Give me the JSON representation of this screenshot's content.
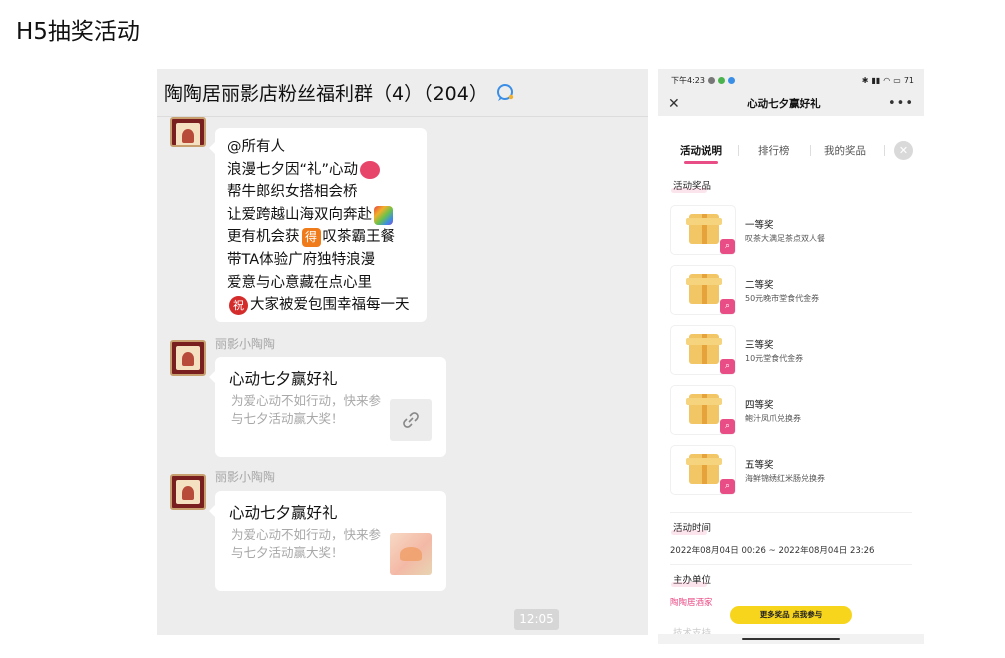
{
  "page_title": "H5抽奖活动",
  "chat": {
    "header": "陶陶居丽影店粉丝福利群（4）（204）",
    "announcement_lines": [
      "@所有人",
      "浪漫七夕因“礼”心动",
      "帮牛郎织女搭相会桥",
      "让爱跨越山海双向奔赴",
      "更有机会获",
      "叹茶霸王餐",
      "带TA体验广府独特浪漫",
      "爱意与心意藏在点心里",
      "大家被爱包围幸福每一天"
    ],
    "emoji_de": "得",
    "emoji_zhu": "祝",
    "messages": [
      {
        "sender": "丽影小陶陶",
        "card_title": "心动七夕赢好礼",
        "card_desc": "为爱心动不如行动，快来参与七夕活动赢大奖！"
      },
      {
        "sender": "丽影小陶陶",
        "card_title": "心动七夕赢好礼",
        "card_desc": "为爱心动不如行动，快来参与七夕活动赢大奖！"
      }
    ],
    "time": "12:05"
  },
  "phone": {
    "status_time": "下午4:23",
    "battery": "71",
    "nav_title": "心动七夕赢好礼",
    "tabs": [
      "活动说明",
      "排行榜",
      "我的奖品"
    ],
    "active_tab": "活动说明",
    "prizes_label": "活动奖品",
    "prizes": [
      {
        "name": "一等奖",
        "desc": "叹茶大满足茶点双人餐"
      },
      {
        "name": "二等奖",
        "desc": "50元晚市堂食代金券"
      },
      {
        "name": "三等奖",
        "desc": "10元堂食代金券"
      },
      {
        "name": "四等奖",
        "desc": "鲍汁凤爪兑换券"
      },
      {
        "name": "五等奖",
        "desc": "海鲜锦绣红米肠兑换券"
      }
    ],
    "time_label": "活动时间",
    "time_value": "2022年08月04日 00:26 ~ 2022年08月04日 23:26",
    "organizer_label": "主办单位",
    "organizer_value": "陶陶居酒家",
    "cta": "更多奖品  点我参与",
    "faded_label": "技术支持"
  },
  "colors": {
    "accent": "#e94d86",
    "cta": "#f7d51d",
    "chat_bg": "#ededed"
  }
}
